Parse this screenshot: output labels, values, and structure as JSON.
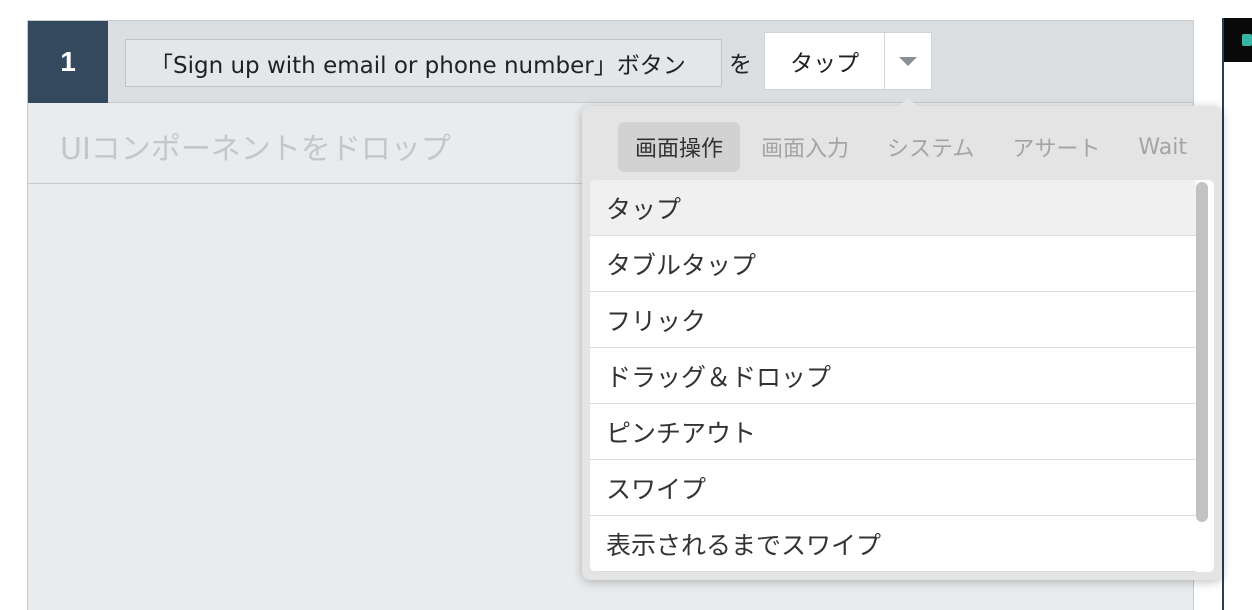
{
  "step": {
    "number": "1",
    "component_label": "「Sign up with email or phone number」ボタン",
    "particle": "を",
    "action_value": "タップ",
    "drop_placeholder": "UIコンポーネントをドロップ"
  },
  "popover": {
    "tabs": [
      {
        "label": "画面操作",
        "active": true
      },
      {
        "label": "画面入力",
        "active": false
      },
      {
        "label": "システム",
        "active": false
      },
      {
        "label": "アサート",
        "active": false
      },
      {
        "label": "Wait",
        "active": false
      }
    ],
    "options": [
      {
        "label": "タップ",
        "selected": true
      },
      {
        "label": "タブルタップ",
        "selected": false
      },
      {
        "label": "フリック",
        "selected": false
      },
      {
        "label": "ドラッグ＆ドロップ",
        "selected": false
      },
      {
        "label": "ピンチアウト",
        "selected": false
      },
      {
        "label": "スワイプ",
        "selected": false
      },
      {
        "label": "表示されるまでスワイプ",
        "selected": false
      }
    ]
  },
  "icons": {
    "dropdown": "chevron-down-icon",
    "edge_app": "app-icon"
  },
  "colors": {
    "step_badge": "#34495e",
    "header_bg": "#dcdfe1",
    "popover_bg": "#e4e4e4",
    "active_tab_bg": "#d2d2d2",
    "accent_teal": "#34b6a6"
  }
}
